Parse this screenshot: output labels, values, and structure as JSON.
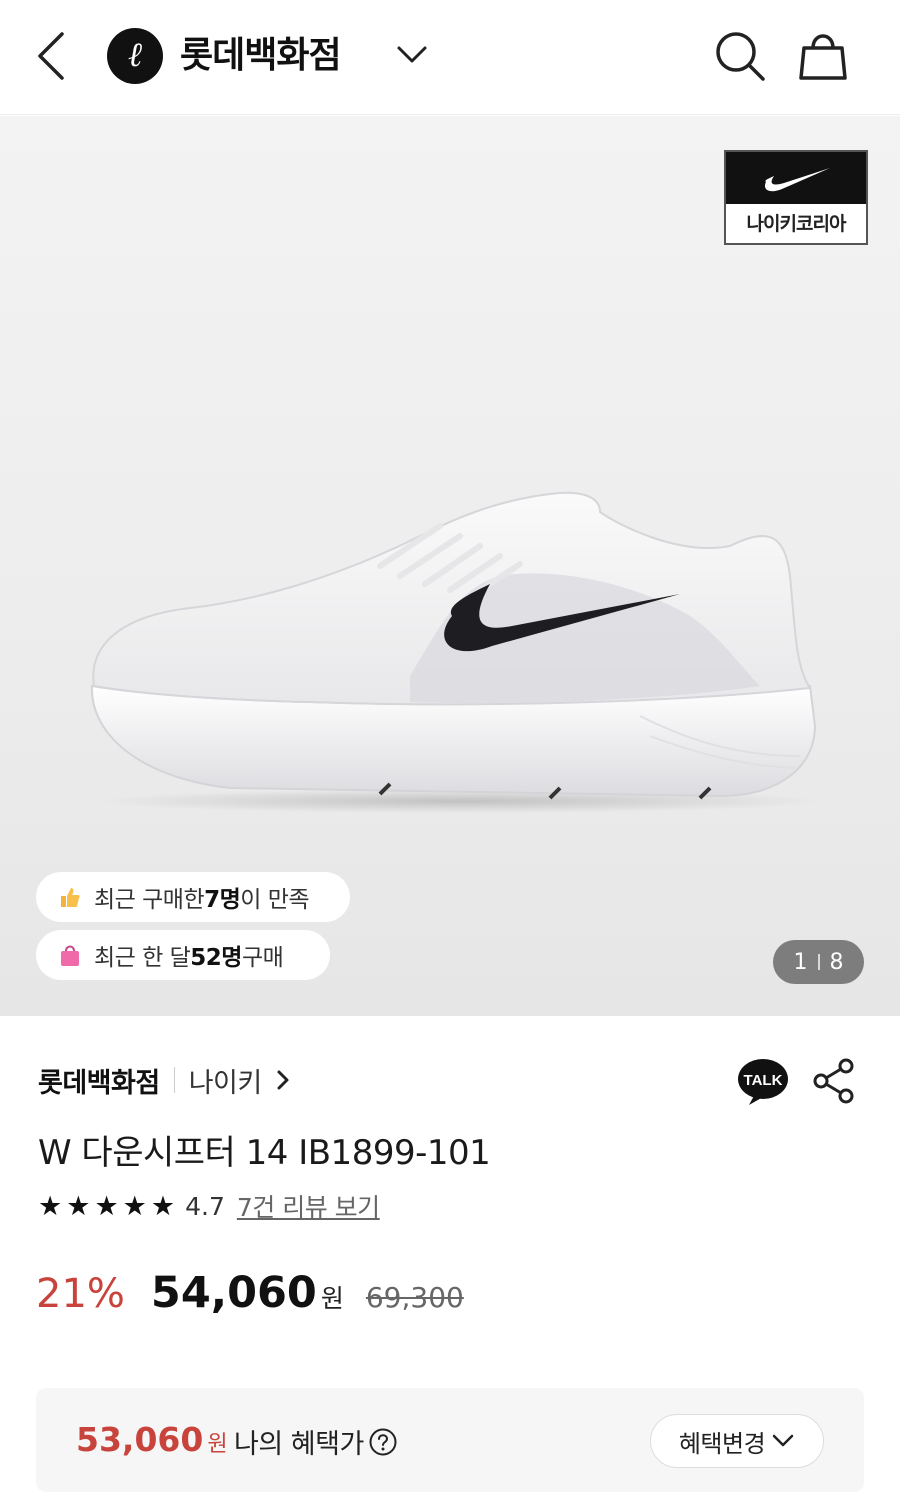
{
  "header": {
    "store_name": "롯데백화점",
    "logo_glyph": "ℓ"
  },
  "hero": {
    "brand_badge_label": "나이키코리아",
    "pill_recent_prefix": "최근 구매한 ",
    "pill_recent_bold": "7명",
    "pill_recent_suffix": "이 만족",
    "pill_month_prefix": "최근 한 달 ",
    "pill_month_bold": "52명",
    "pill_month_suffix": " 구매",
    "pager_current": "1",
    "pager_total": "8"
  },
  "product": {
    "seller": "롯데백화점",
    "brand": "나이키",
    "talk_label": "TALK",
    "title": "W 다운시프터 14 IB1899-101",
    "rating": "4.7",
    "rating_stars": 4.7,
    "review_link": "7건 리뷰 보기",
    "discount": "21%",
    "price": "54,060",
    "currency": "원",
    "original_price": "69,300"
  },
  "benefit": {
    "price": "53,060",
    "currency": "원",
    "label": "나의 혜택가",
    "change_button": "혜택변경"
  },
  "colors": {
    "accent_red": "#c9433d",
    "text_dark": "#111111"
  }
}
